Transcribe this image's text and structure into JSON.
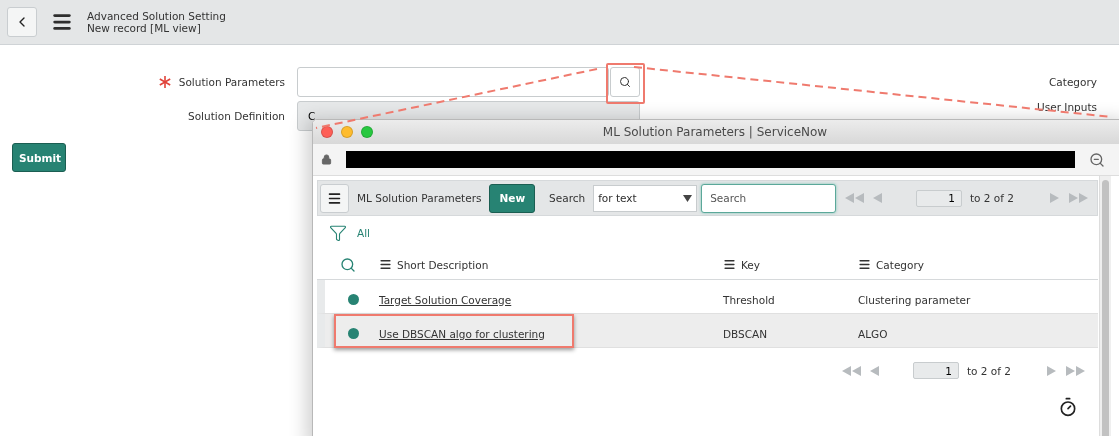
{
  "header": {
    "title": "Advanced Solution Setting",
    "subtitle": "New record [ML view]"
  },
  "form": {
    "fields": [
      {
        "label": "Solution Parameters",
        "required": true,
        "kind": "lookup",
        "highlighted": true
      },
      {
        "label": "Solution Definition",
        "required": false,
        "kind": "readonly",
        "value": "C",
        "highlighted": false
      }
    ],
    "right_labels": [
      "Category",
      "User Inputs"
    ],
    "submit": "Submit"
  },
  "popup": {
    "title": "ML Solution Parameters | ServiceNow",
    "list_title": "ML Solution Parameters",
    "new_button": "New",
    "search_label": "Search",
    "search_scope": "for text",
    "search_placeholder": "Search",
    "page": "1",
    "range": "to 2 of 2",
    "filter": "All",
    "columns": [
      "Short Description",
      "Key",
      "Category"
    ],
    "rows": [
      {
        "description": "Target Solution Coverage",
        "key": "Threshold",
        "category": "Clustering parameter",
        "selected": false,
        "highlighted": false
      },
      {
        "description": "Use DBSCAN algo for clustering",
        "key": "DBSCAN",
        "category": "ALGO",
        "selected": true,
        "highlighted": true
      }
    ],
    "bottom_page": "1",
    "bottom_range": "to 2 of 2"
  }
}
